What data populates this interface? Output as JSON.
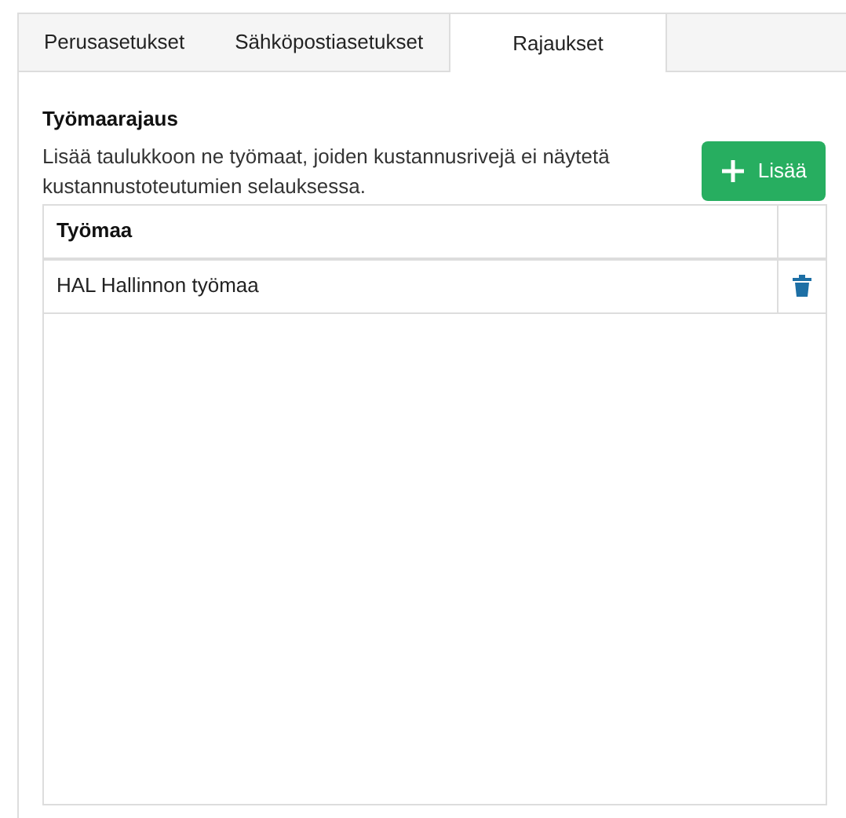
{
  "tabs": [
    {
      "label": "Perusasetukset",
      "selected": false
    },
    {
      "label": "Sähköpostiasetukset",
      "selected": false
    },
    {
      "label": "Rajaukset",
      "selected": true
    }
  ],
  "section": {
    "title": "Työmaarajaus",
    "description": "Lisää taulukkoon ne työmaat, joiden kustannusrivejä ei näytetä kustannustoteutumien selauksessa.",
    "add_button": "Lisää"
  },
  "table": {
    "columns": [
      "Työmaa"
    ],
    "rows": [
      {
        "name": "HAL Hallinnon työmaa"
      }
    ]
  }
}
